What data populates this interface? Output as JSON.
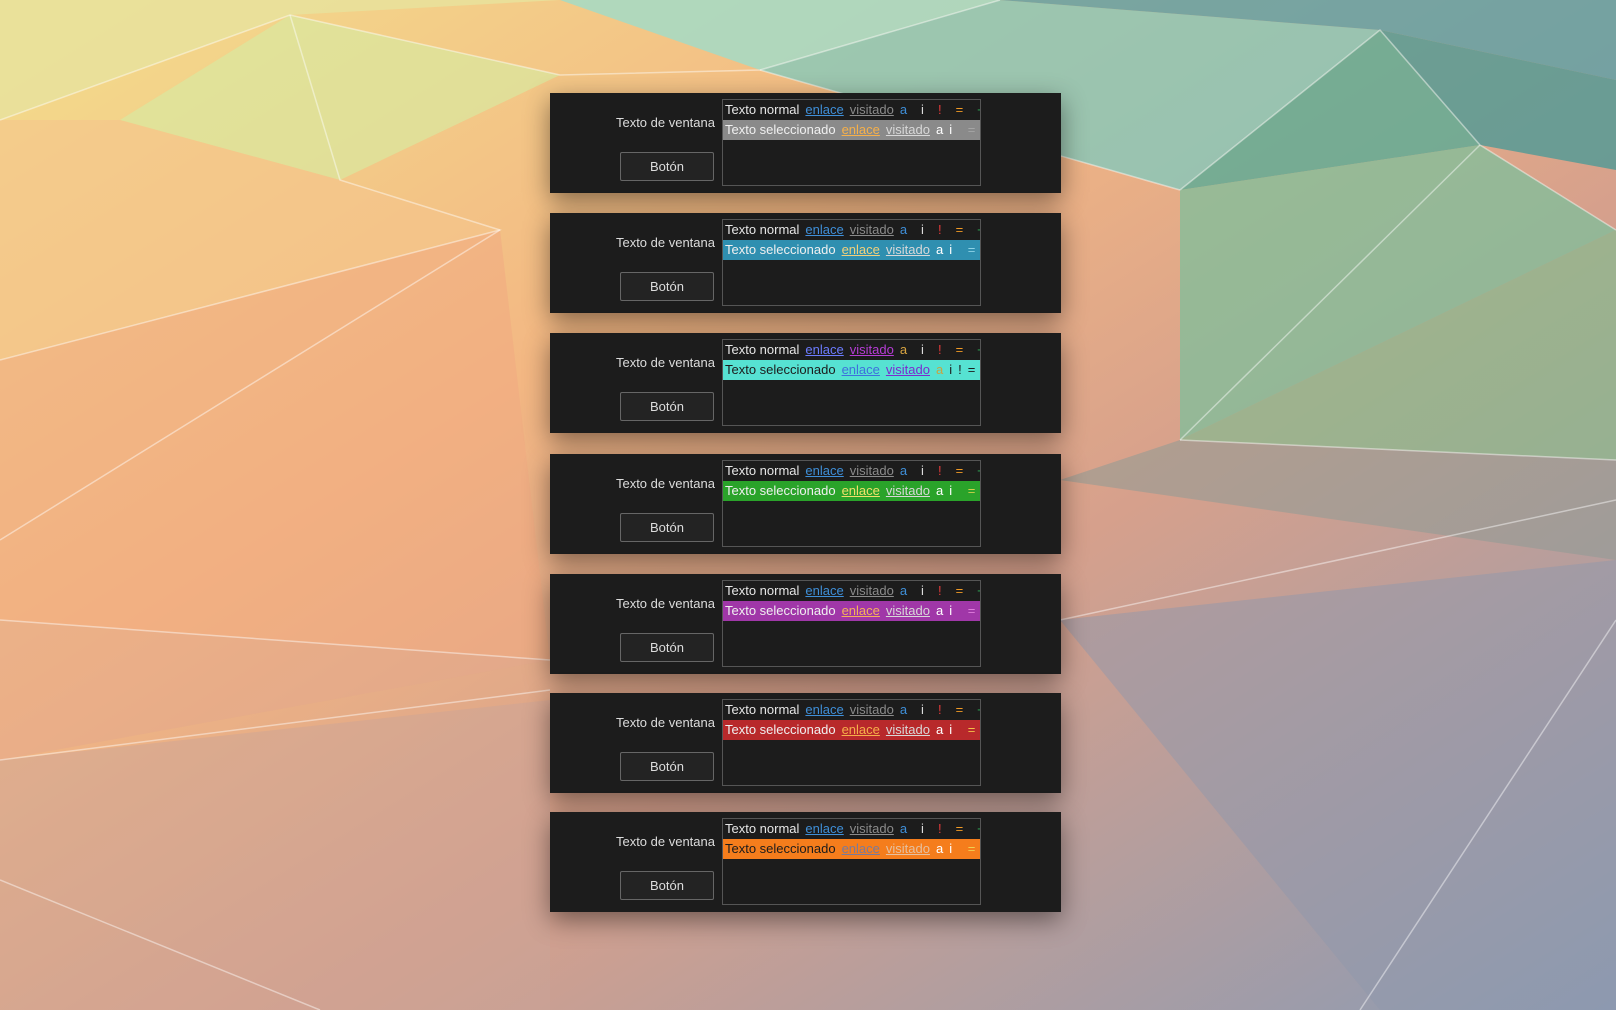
{
  "colors": {
    "panel_bg": "#1c1c1c",
    "window_text": "#dcdcdc",
    "normal_text": "#e6e6e6"
  },
  "panels": [
    {
      "window_label": "Texto de ventana",
      "button_label": "Botón",
      "normal_row": {
        "text": "Texto normal",
        "link": "enlace",
        "visited": "visitado",
        "a": "a",
        "i": "i",
        "bang": "!",
        "eq": "=",
        "plus": "+"
      },
      "selected_row": {
        "text": "Texto seleccionado",
        "link": "enlace",
        "visited": "visitado",
        "a": "a",
        "i": "i",
        "bang": "!",
        "eq": "=",
        "plus": "+"
      },
      "palette": {
        "selection_bg": "#8a8a8a",
        "selection_text": "#f0f0f0",
        "link": "#3f8fd8",
        "visited": "#8b8b8b",
        "a": "#3f8fd8",
        "i": "#dcdcdc",
        "bang": "#e03a3a",
        "eq": "#f19a25",
        "plus": "#2fb55a",
        "sel_link": "#f6b04a",
        "sel_visited": "#d8d8d8",
        "sel_a": "#ffffff",
        "sel_i": "#ffffff",
        "sel_bang": "#8a8a8a",
        "sel_eq": "#a5a5a5",
        "sel_plus": "#a5a5a5"
      }
    },
    {
      "window_label": "Texto de ventana",
      "button_label": "Botón",
      "normal_row": {
        "text": "Texto normal",
        "link": "enlace",
        "visited": "visitado",
        "a": "a",
        "i": "i",
        "bang": "!",
        "eq": "=",
        "plus": "+"
      },
      "selected_row": {
        "text": "Texto seleccionado",
        "link": "enlace",
        "visited": "visitado",
        "a": "a",
        "i": "i",
        "bang": "!",
        "eq": "=",
        "plus": "+"
      },
      "palette": {
        "selection_bg": "#2f8fb0",
        "selection_text": "#f0f0f0",
        "link": "#3f8fd8",
        "visited": "#8b8b8b",
        "a": "#3f8fd8",
        "i": "#dcdcdc",
        "bang": "#e03a3a",
        "eq": "#f19a25",
        "plus": "#2fb55a",
        "sel_link": "#f3d07a",
        "sel_visited": "#d8d8d8",
        "sel_a": "#ffffff",
        "sel_i": "#ffffff",
        "sel_bang": "#2f8fb0",
        "sel_eq": "#8ed2e6",
        "sel_plus": "#2f8fb0"
      }
    },
    {
      "window_label": "Texto de ventana",
      "button_label": "Botón",
      "normal_row": {
        "text": "Texto normal",
        "link": "enlace",
        "visited": "visitado",
        "a": "a",
        "i": "i",
        "bang": "!",
        "eq": "=",
        "plus": "+"
      },
      "selected_row": {
        "text": "Texto seleccionado",
        "link": "enlace",
        "visited": "visitado",
        "a": "a",
        "i": "i",
        "bang": "!",
        "eq": "=",
        "plus": "+"
      },
      "palette": {
        "selection_bg": "#56e2d2",
        "selection_text": "#1c1c1c",
        "link": "#6c7cff",
        "visited": "#b63dd6",
        "a": "#d9a542",
        "i": "#dcdcdc",
        "bang": "#e03a3a",
        "eq": "#f19a25",
        "plus": "#2fb55a",
        "sel_link": "#3f6fdc",
        "sel_visited": "#7b2ad0",
        "sel_a": "#c9a340",
        "sel_i": "#1c1c1c",
        "sel_bang": "#1c1c1c",
        "sel_eq": "#1c1c1c",
        "sel_plus": "#1c1c1c"
      }
    },
    {
      "window_label": "Texto de ventana",
      "button_label": "Botón",
      "normal_row": {
        "text": "Texto normal",
        "link": "enlace",
        "visited": "visitado",
        "a": "a",
        "i": "i",
        "bang": "!",
        "eq": "=",
        "plus": "+"
      },
      "selected_row": {
        "text": "Texto seleccionado",
        "link": "enlace",
        "visited": "visitado",
        "a": "a",
        "i": "i",
        "bang": "!",
        "eq": "=",
        "plus": "+"
      },
      "palette": {
        "selection_bg": "#2aa32a",
        "selection_text": "#f0f0f0",
        "link": "#3f8fd8",
        "visited": "#8b8b8b",
        "a": "#3f8fd8",
        "i": "#dcdcdc",
        "bang": "#e03a3a",
        "eq": "#f19a25",
        "plus": "#2fb55a",
        "sel_link": "#f2e06a",
        "sel_visited": "#d8d8d8",
        "sel_a": "#ffffff",
        "sel_i": "#ffffff",
        "sel_bang": "#2aa32a",
        "sel_eq": "#d0d04a",
        "sel_plus": "#2aa32a"
      }
    },
    {
      "window_label": "Texto de ventana",
      "button_label": "Botón",
      "normal_row": {
        "text": "Texto normal",
        "link": "enlace",
        "visited": "visitado",
        "a": "a",
        "i": "i",
        "bang": "!",
        "eq": "=",
        "plus": "+"
      },
      "selected_row": {
        "text": "Texto seleccionado",
        "link": "enlace",
        "visited": "visitado",
        "a": "a",
        "i": "i",
        "bang": "!",
        "eq": "=",
        "plus": "+"
      },
      "palette": {
        "selection_bg": "#a037a8",
        "selection_text": "#f0f0f0",
        "link": "#3f8fd8",
        "visited": "#8b8b8b",
        "a": "#3f8fd8",
        "i": "#dcdcdc",
        "bang": "#e03a3a",
        "eq": "#f19a25",
        "plus": "#2fb55a",
        "sel_link": "#f4b35a",
        "sel_visited": "#d8d8d8",
        "sel_a": "#ffffff",
        "sel_i": "#ffffff",
        "sel_bang": "#a037a8",
        "sel_eq": "#e07fdd",
        "sel_plus": "#6fd67f"
      }
    },
    {
      "window_label": "Texto de ventana",
      "button_label": "Botón",
      "normal_row": {
        "text": "Texto normal",
        "link": "enlace",
        "visited": "visitado",
        "a": "a",
        "i": "i",
        "bang": "!",
        "eq": "=",
        "plus": "+"
      },
      "selected_row": {
        "text": "Texto seleccionado",
        "link": "enlace",
        "visited": "visitado",
        "a": "a",
        "i": "i",
        "bang": "!",
        "eq": "=",
        "plus": "+"
      },
      "palette": {
        "selection_bg": "#b8292b",
        "selection_text": "#f0f0f0",
        "link": "#3f8fd8",
        "visited": "#8b8b8b",
        "a": "#3f8fd8",
        "i": "#dcdcdc",
        "bang": "#e03a3a",
        "eq": "#f19a25",
        "plus": "#2fb55a",
        "sel_link": "#f6b04a",
        "sel_visited": "#d8d8d8",
        "sel_a": "#ffffff",
        "sel_i": "#ffffff",
        "sel_bang": "#b8292b",
        "sel_eq": "#f2c04a",
        "sel_plus": "#6fd67f"
      }
    },
    {
      "window_label": "Texto de ventana",
      "button_label": "Botón",
      "normal_row": {
        "text": "Texto normal",
        "link": "enlace",
        "visited": "visitado",
        "a": "a",
        "i": "i",
        "bang": "!",
        "eq": "=",
        "plus": "+"
      },
      "selected_row": {
        "text": "Texto seleccionado",
        "link": "enlace",
        "visited": "visitado",
        "a": "a",
        "i": "i",
        "bang": "!",
        "eq": "=",
        "plus": "+"
      },
      "palette": {
        "selection_bg": "#f57d1c",
        "selection_text": "#1c1c1c",
        "link": "#3f8fd8",
        "visited": "#8b8b8b",
        "a": "#3f8fd8",
        "i": "#dcdcdc",
        "bang": "#e03a3a",
        "eq": "#f19a25",
        "plus": "#2fb55a",
        "sel_link": "#7a7a9a",
        "sel_visited": "#e5c0a0",
        "sel_a": "#ffffff",
        "sel_i": "#ffffff",
        "sel_bang": "#f57d1c",
        "sel_eq": "#f0d050",
        "sel_plus": "#3f8f3f"
      }
    }
  ]
}
